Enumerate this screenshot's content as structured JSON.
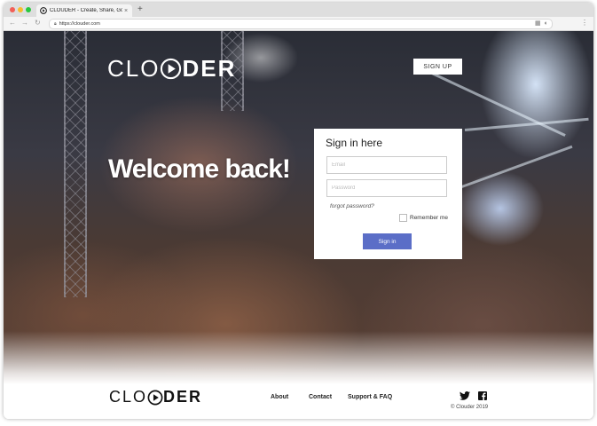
{
  "browser": {
    "tab_title": "CLOUDER - Create, Share, Go.",
    "tab_close": "×",
    "new_tab": "+",
    "url": "https://clouder.com",
    "nav": {
      "back": "←",
      "forward": "→",
      "reload": "↻"
    },
    "menu": "⋮"
  },
  "brand": {
    "light": "CLO",
    "heavy": "DER"
  },
  "header": {
    "signup_label": "SIGN UP"
  },
  "hero": {
    "headline": "Welcome back!"
  },
  "signin_form": {
    "title": "Sign in here",
    "email_placeholder": "Email",
    "password_placeholder": "Password",
    "forgot_label": "forgot password?",
    "remember_label": "Remember me",
    "submit_label": "Sign in"
  },
  "footer": {
    "links": [
      "About",
      "Contact",
      "Support & FAQ"
    ],
    "copyright": "© Clouder 2019"
  },
  "icons": {
    "play": "play-icon",
    "twitter": "twitter-icon",
    "facebook": "facebook-icon"
  },
  "colors": {
    "accent": "#5b6ec7"
  }
}
